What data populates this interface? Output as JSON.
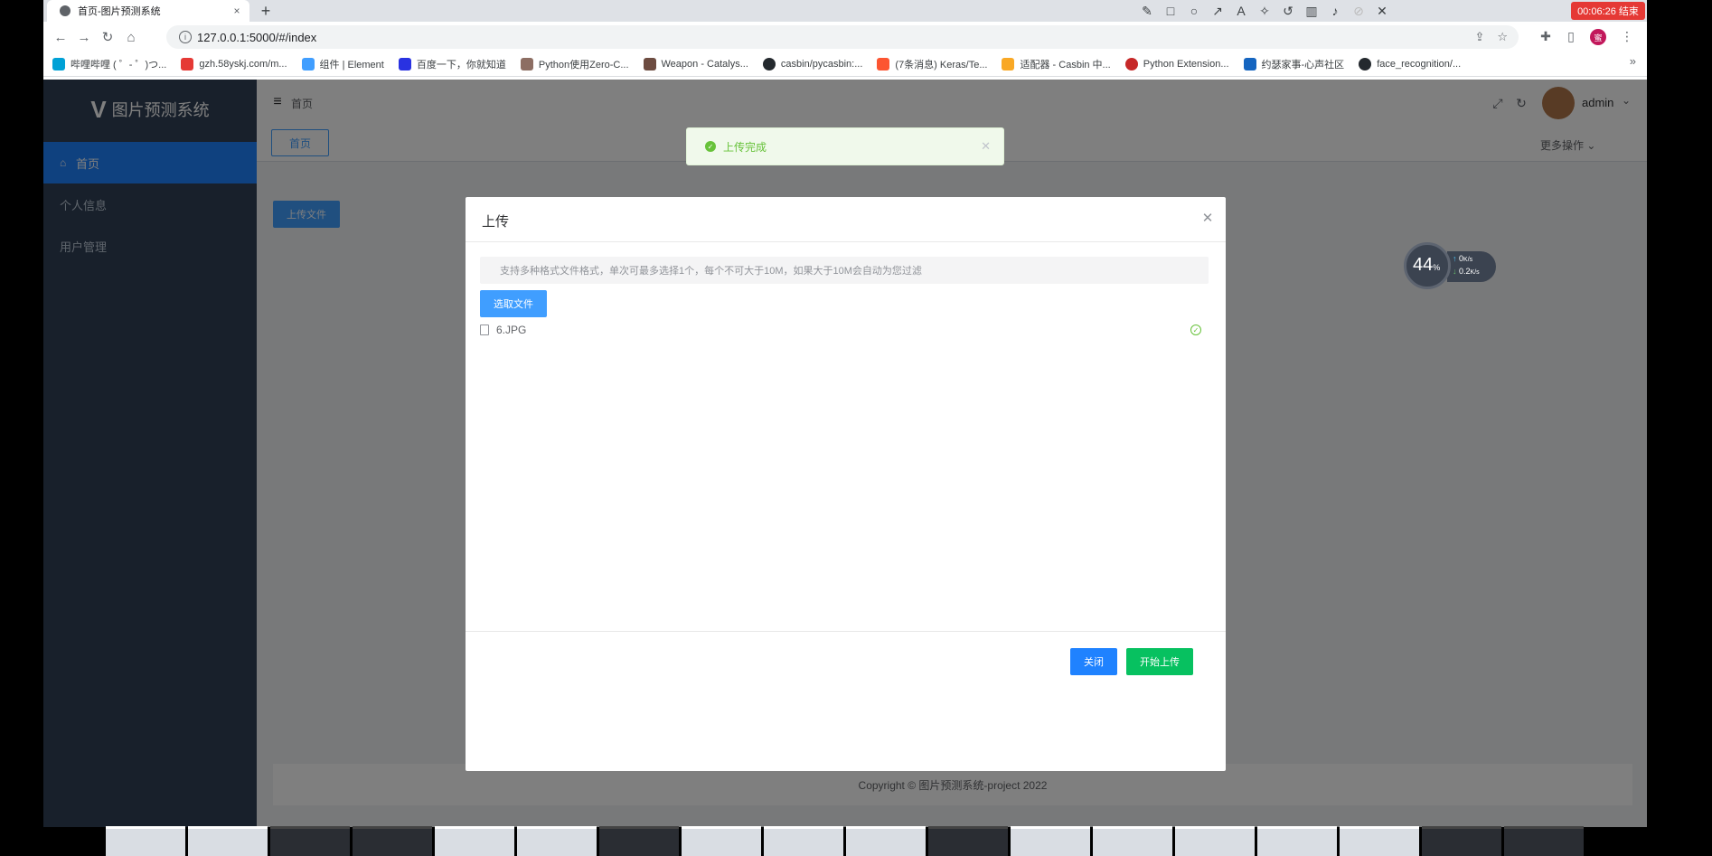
{
  "browser": {
    "tab_title": "首页-图片预测系统",
    "tab_close": "×",
    "new_tab": "+",
    "url": "127.0.0.1:5000/#/index",
    "recorder_timer": "00:06:26 结束",
    "profile_initial": "蜜",
    "bookmarks": [
      {
        "label": "哔哩哔哩 ( ゜- ゜)つ...",
        "color": "#00a1d6"
      },
      {
        "label": "gzh.58yskj.com/m...",
        "color": "#e53935"
      },
      {
        "label": "组件 | Element",
        "color": "#409eff"
      },
      {
        "label": "百度一下，你就知道",
        "color": "#2932e1"
      },
      {
        "label": "Python使用Zero-C...",
        "color": "#8d6e63"
      },
      {
        "label": "Weapon - Catalys...",
        "color": "#6d4c41"
      },
      {
        "label": "casbin/pycasbin:...",
        "color": "#24292e"
      },
      {
        "label": "(7条消息) Keras/Te...",
        "color": "#fc5531"
      },
      {
        "label": "适配器 - Casbin 中...",
        "color": "#f9a825"
      },
      {
        "label": "Python Extension...",
        "color": "#c62828"
      },
      {
        "label": "约瑟家事-心声社区",
        "color": "#1565c0"
      },
      {
        "label": "face_recognition/...",
        "color": "#24292e"
      }
    ],
    "bookmarks_more": "»"
  },
  "app": {
    "logo": "V",
    "system_name": "图片预测系统",
    "menu": [
      {
        "label": "首页",
        "icon": "home-icon"
      },
      {
        "label": "个人信息",
        "icon": ""
      },
      {
        "label": "用户管理",
        "icon": ""
      }
    ],
    "breadcrumb": "首页",
    "username": "admin",
    "tag_home": "首页",
    "more_ops": "更多操作",
    "upload_file_btn": "上传文件",
    "footer": "Copyright © 图片预测系统-project 2022"
  },
  "toast": {
    "message": "上传完成"
  },
  "dialog": {
    "title": "上传",
    "tip": "支持多种格式文件格式，单次可最多选择1个，每个不可大于10M，如果大于10M会自动为您过滤",
    "pick_btn": "选取文件",
    "file_name": "6.JPG",
    "close_btn": "关闭",
    "start_btn": "开始上传"
  },
  "net_widget": {
    "percent": "44",
    "percent_unit": "%",
    "up_value": "0",
    "down_value": "0.2",
    "unit": "K/s"
  }
}
